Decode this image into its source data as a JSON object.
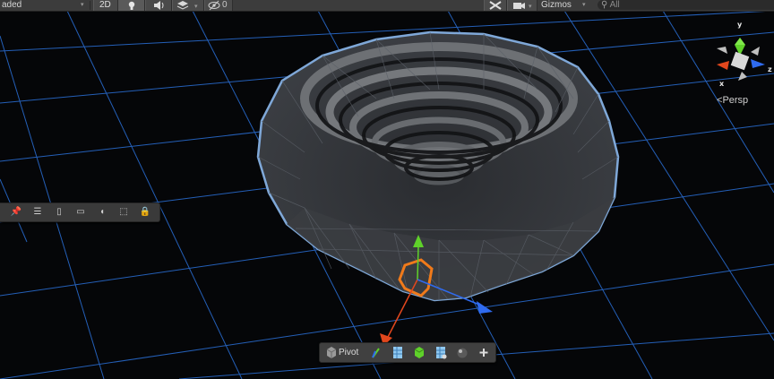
{
  "toolbar": {
    "shading_mode": "aded",
    "mode_2d": "2D",
    "hidden_count": "0",
    "gizmos_label": "Gizmos",
    "search_placeholder": "All"
  },
  "scene": {
    "projection_label": "Persp",
    "gizmo_axes": {
      "x": "x",
      "y": "y",
      "z": "z"
    },
    "colors": {
      "background": "#050608",
      "grid": "#2a6fd6",
      "mesh_outline": "#7fa8d8",
      "selection": "#f07a1a",
      "x_axis": "#e2471d",
      "y_axis": "#5fd12a",
      "z_axis": "#2f6bf0"
    }
  },
  "bottom_toolbar": {
    "pivot_label": "Pivot"
  }
}
